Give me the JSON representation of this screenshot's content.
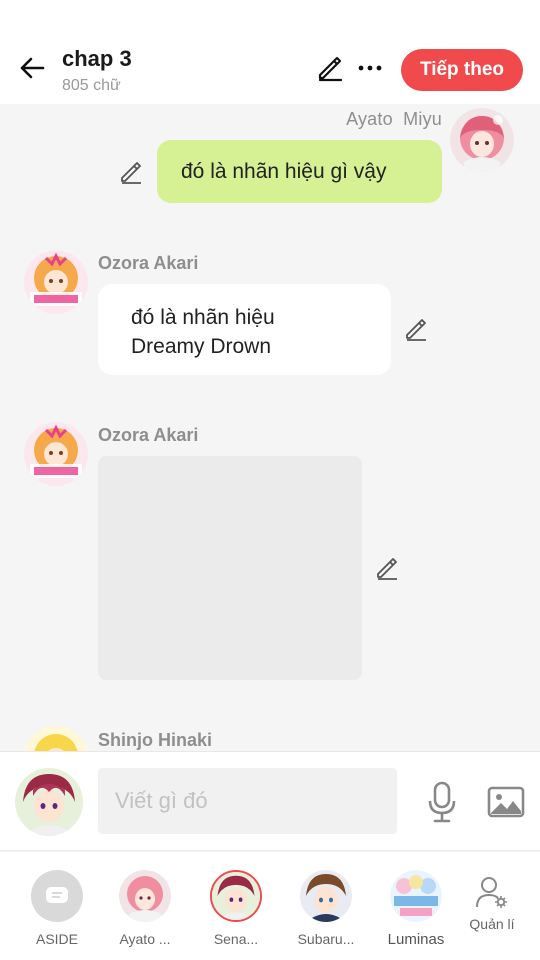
{
  "header": {
    "title": "chap 3",
    "word_count": "805 chữ",
    "next_label": "Tiếp theo",
    "accent": "#f04a4d"
  },
  "chat": {
    "messages": [
      {
        "sender": "Ayato  Miyu",
        "side": "right",
        "text": "đó là nhãn hiệu gì vậy",
        "bubble_color": "#d6f094"
      },
      {
        "sender": "Ozora Akari",
        "side": "left",
        "text_lines": [
          "đó là nhãn hiệu",
          "Dreamy Drown"
        ]
      },
      {
        "sender": "Ozora Akari",
        "side": "left",
        "image": "image-placeholder"
      },
      {
        "sender": "Shinjo Hinaki",
        "side": "left"
      }
    ]
  },
  "input": {
    "placeholder": "Viết gì đó",
    "mic_icon": "microphone-icon",
    "image_icon": "image-icon"
  },
  "characters": [
    {
      "label": "ASIDE",
      "icon": "message-icon"
    },
    {
      "label": "Ayato ..."
    },
    {
      "label": "Sena..."
    },
    {
      "label": "Subaru..."
    },
    {
      "label": "Luminas"
    },
    {
      "label": "Quản lí",
      "icon": "user-settings-icon"
    }
  ]
}
